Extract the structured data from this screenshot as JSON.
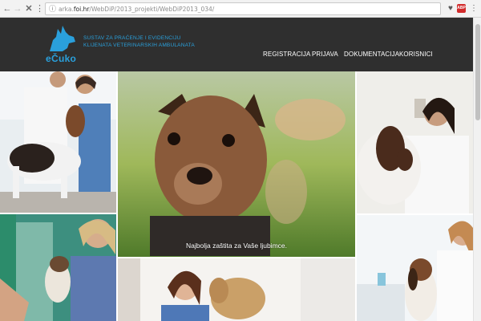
{
  "browser": {
    "url_prefix": "arka.",
    "url_domain": "foi.hr",
    "url_path": "/WebDiP/2013_projekti/WebDiP2013_034/"
  },
  "site": {
    "brand": "eČuko",
    "tagline_line1": "SUSTAV ZA PRAĆENJE I EVIDENCIJU",
    "tagline_line2": "KLIJENATA VETERINARSKIH AMBULANATA",
    "menu": [
      "REGISTRACIJA",
      "PRIJAVA",
      "DOKUMENTACIJA",
      "KORISNICI"
    ],
    "caption": "Najbolja zaštita za Vaše ljubimce.",
    "accent_color": "#2aa0dc",
    "header_color": "#2f2f2f"
  }
}
